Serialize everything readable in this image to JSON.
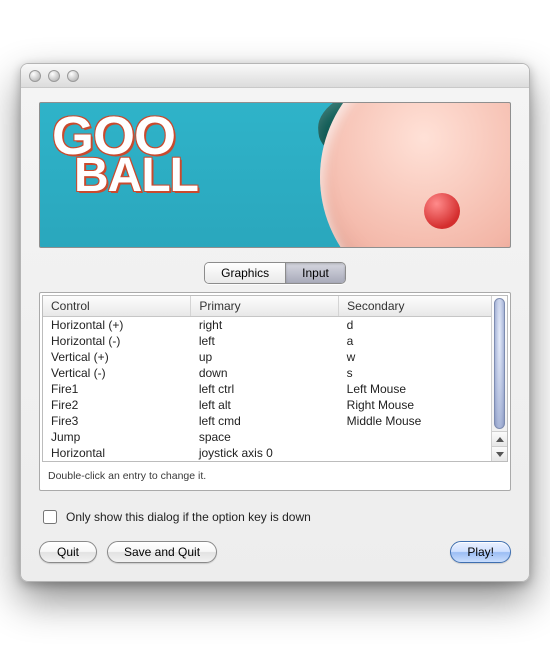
{
  "appTitle": "GooBall",
  "logo": {
    "line1": "GOO",
    "line2": "BALL"
  },
  "tabs": {
    "graphics": "Graphics",
    "input": "Input",
    "active": "input"
  },
  "columns": {
    "control": "Control",
    "primary": "Primary",
    "secondary": "Secondary"
  },
  "rows": [
    {
      "control": "Horizontal (+)",
      "primary": "right",
      "secondary": "d"
    },
    {
      "control": "Horizontal (-)",
      "primary": "left",
      "secondary": "a"
    },
    {
      "control": "Vertical (+)",
      "primary": "up",
      "secondary": "w"
    },
    {
      "control": "Vertical (-)",
      "primary": "down",
      "secondary": "s"
    },
    {
      "control": "Fire1",
      "primary": "left ctrl",
      "secondary": "Left Mouse"
    },
    {
      "control": "Fire2",
      "primary": "left alt",
      "secondary": "Right Mouse"
    },
    {
      "control": "Fire3",
      "primary": "left cmd",
      "secondary": "Middle Mouse"
    },
    {
      "control": "Jump",
      "primary": "space",
      "secondary": ""
    },
    {
      "control": "Horizontal",
      "primary": "joystick axis 0",
      "secondary": ""
    }
  ],
  "hint": "Double-click an entry to change it.",
  "checkbox": {
    "label": "Only show this dialog if the option key is down",
    "checked": false
  },
  "buttons": {
    "quit": "Quit",
    "saveQuit": "Save and Quit",
    "play": "Play!"
  }
}
